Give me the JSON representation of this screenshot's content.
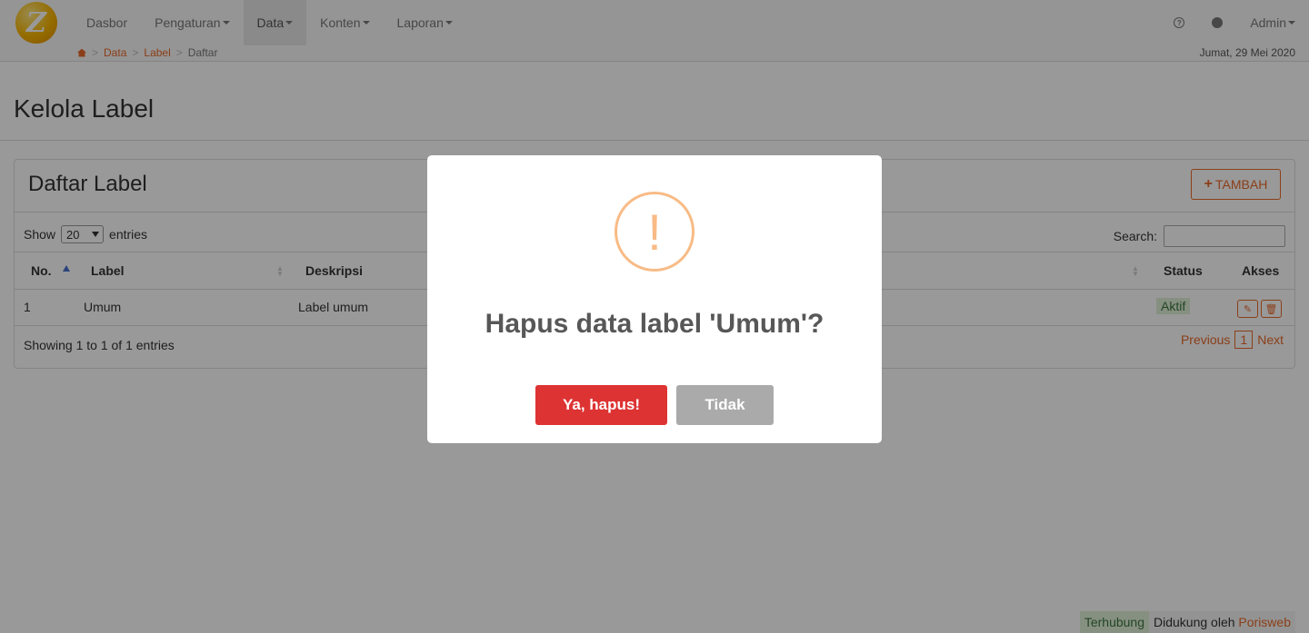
{
  "nav": {
    "items": [
      {
        "label": "Dasbor",
        "dropdown": false,
        "active": false
      },
      {
        "label": "Pengaturan",
        "dropdown": true,
        "active": false
      },
      {
        "label": "Data",
        "dropdown": true,
        "active": true
      },
      {
        "label": "Konten",
        "dropdown": true,
        "active": false
      },
      {
        "label": "Laporan",
        "dropdown": true,
        "active": false
      }
    ],
    "help_icon": "question-circle-icon",
    "globe_icon": "globe-icon",
    "user_label": "Admin"
  },
  "breadcrumb": {
    "home_icon": "home-icon",
    "items": [
      "Data",
      "Label"
    ],
    "current": "Daftar",
    "separator": ">"
  },
  "date": "Jumat, 29 Mei 2020",
  "page": {
    "title": "Kelola Label"
  },
  "panel": {
    "title": "Daftar Label",
    "add_button": "TAMBAH",
    "show_label": "Show",
    "entries_label": "entries",
    "page_size": "20",
    "search_label": "Search:",
    "columns": [
      "No.",
      "Label",
      "Deskripsi",
      "Status",
      "Akses"
    ],
    "rows": [
      {
        "no": "1",
        "label": "Umum",
        "deskripsi": "Label umum",
        "status": "Aktif"
      }
    ],
    "info": "Showing 1 to 1 of 1 entries",
    "pager": {
      "previous": "Previous",
      "current_page": "1",
      "next": "Next"
    }
  },
  "footer": {
    "connected": "Terhubung",
    "powered_by": "Didukung oleh",
    "brand": "Porisweb"
  },
  "modal": {
    "title": "Hapus data label 'Umum'?",
    "confirm_button": "Ya, hapus!",
    "cancel_button": "Tidak",
    "icon": "warning-icon"
  },
  "colors": {
    "accent": "#e8692a",
    "danger": "#dd3333",
    "cancel": "#aaaaaa",
    "warning": "#f8bb86",
    "success_bg": "#dff0d8"
  }
}
